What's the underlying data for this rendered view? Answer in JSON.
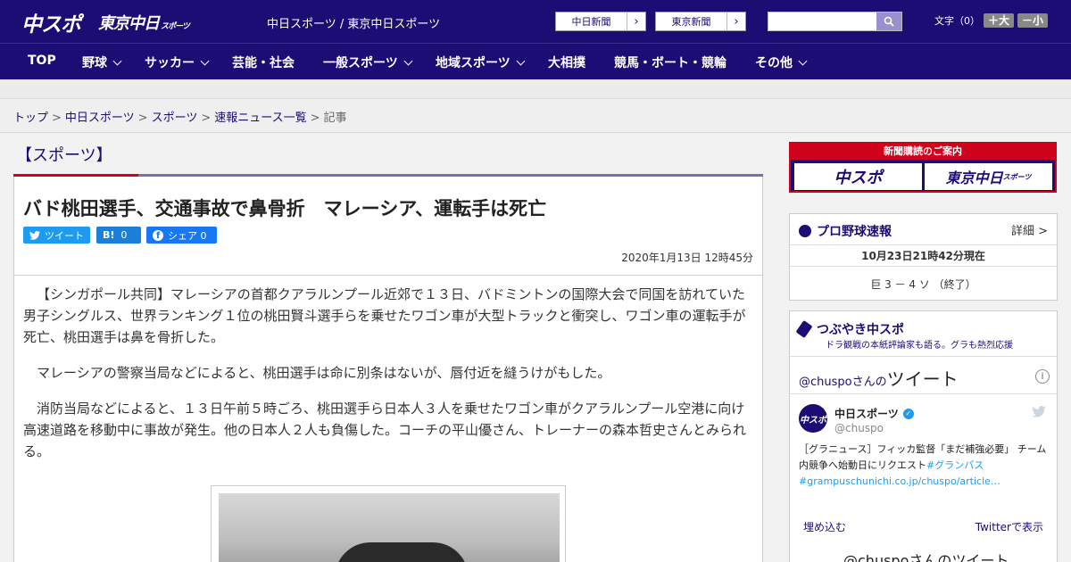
{
  "header": {
    "logo_main": "中スポ",
    "logo_tokyo": "東京中日",
    "logo_tokyo_small": "スポーツ",
    "site_name": "中日スポーツ / 東京中日スポーツ",
    "link1": "中日新聞",
    "link2": "東京新聞",
    "arrow": "›",
    "font_label": "文字（0）",
    "font_plus": "＋大",
    "font_minus": "－小"
  },
  "nav": {
    "items": [
      "TOP",
      "野球",
      "サッカー",
      "芸能・社会",
      "一般スポーツ",
      "地域スポーツ",
      "大相撲",
      "競馬・ボート・競輪",
      "その他"
    ]
  },
  "breadcrumb": {
    "top": "トップ",
    "chunichi": "中日スポーツ",
    "sports": "スポーツ",
    "news": "速報ニュース一覧",
    "current": "記事",
    "sep": ">"
  },
  "article": {
    "category": "【スポーツ】",
    "headline": "バド桃田選手、交通事故で鼻骨折　マレーシア、運転手は死亡",
    "share_tw": "ツイート",
    "share_hb_icon": "B!",
    "share_hb_count": "0",
    "share_fb": "シェア 0",
    "date": "2020年1月13日 12時45分",
    "paragraphs": [
      "【シンガポール共同】マレーシアの首都クアラルンプール近郊で１３日、バドミントンの国際大会で同国を訪れていた男子シングルス、世界ランキング１位の桃田賢斗選手らを乗せたワゴン車が大型トラックと衝突し、ワゴン車の運転手が死亡、桃田選手は鼻を骨折した。",
      "マレーシアの警察当局などによると、桃田選手は命に別条はないが、唇付近を縫うけがもした。",
      "消防当局などによると、１３日午前５時ごろ、桃田選手ら日本人３人を乗せたワゴン車がクアラルンプール空港に向け高速道路を移動中に事故が発生。他の日本人２人も負傷した。コーチの平山優さん、トレーナーの森本哲史さんとみられる。"
    ]
  },
  "sidebar": {
    "ad_top": "新聞購読のご案内",
    "ad_b1": "中スポ",
    "ad_b2": "東京中日",
    "ad_b2_small": "スポーツ",
    "baseball_title": "プロ野球速報",
    "baseball_more": "詳細 >",
    "baseball_time": "10月23日21時42分現在",
    "baseball_score": "巨 3 － 4 ソ （終了）",
    "tweet_title": "つぶやき中スポ",
    "tweet_sub": "ドラ観戦の本紙評論家も語る。グラも熱烈応援",
    "tweet_hdr_handle": "@chuspoさんの",
    "tweet_hdr_word": "ツイート",
    "tweet_user": "中日スポーツ",
    "tweet_handle": "@chuspo",
    "tweet_text": "［グラニュース］フィッカ監督「まだ補強必要」 チーム内競争へ始動日にリクエスト",
    "tweet_tag": "#グランパス",
    "tweet_link": "#grampuschunichi.co.jp/chuspo/article…",
    "tweet_embed": "埋め込む",
    "tweet_view": "Twitterで表示",
    "tweet_bottom": "@chuspoさんのツイート",
    "avatar_text": "中スポ"
  }
}
